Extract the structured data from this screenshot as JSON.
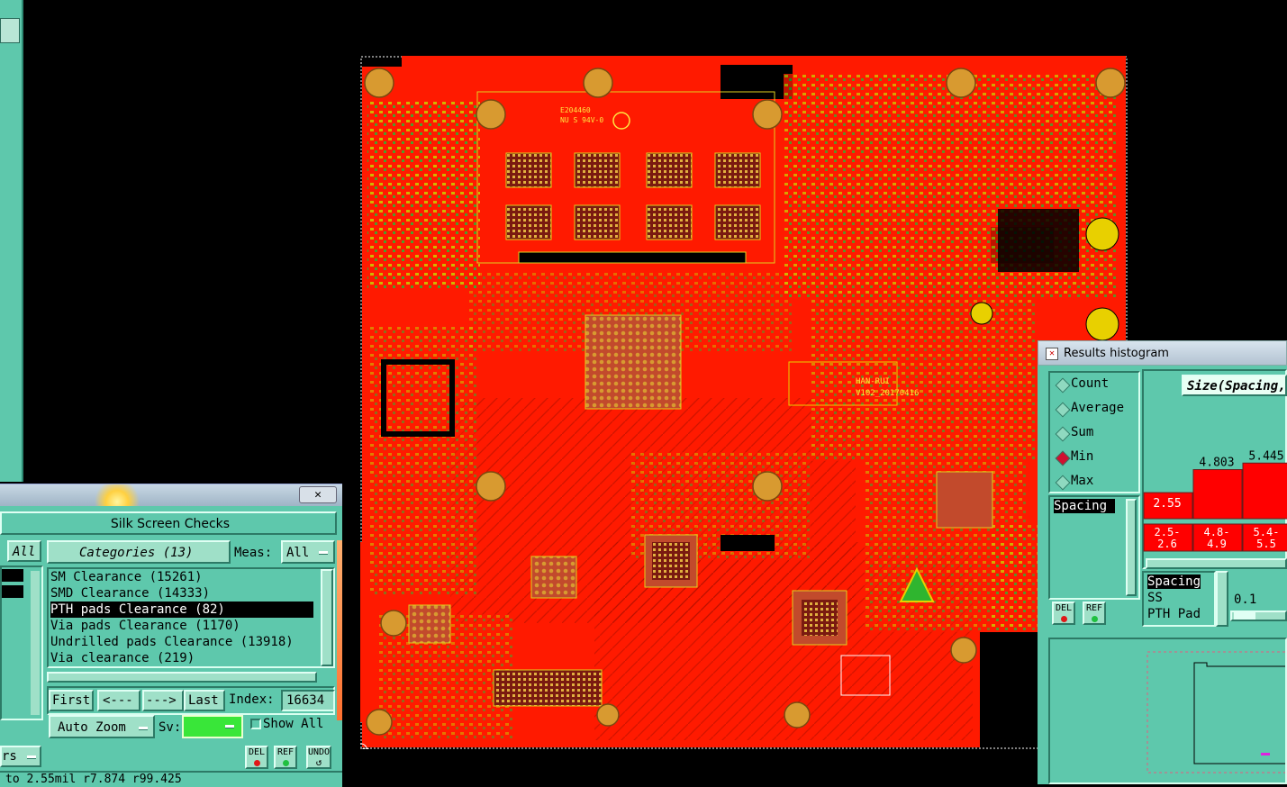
{
  "board": {
    "silk_texts": [
      "E204460",
      "NU S 94V-0",
      "HAN-RUI",
      "V102_20170416"
    ]
  },
  "silk_panel": {
    "title": "Silk Screen Checks",
    "close_symbol": "✕",
    "all_label": "All",
    "categories_label": "Categories (13)",
    "meas_label": "Meas:",
    "meas_value": "All",
    "categories": [
      "SM Clearance (15261)",
      "SMD Clearance (14333)",
      "PTH pads Clearance (82)",
      "Via pads Clearance (1170)",
      "Undrilled pads Clearance (13918)",
      "Via clearance (219)"
    ],
    "selected_index": 2,
    "nav": {
      "first": "First",
      "prev": "<---",
      "next": "--->",
      "last": "Last"
    },
    "index_label": "Index:",
    "index_value": "16634",
    "auto_zoom_label": "Auto Zoom",
    "sv_label": "Sv:",
    "show_all_label": "Show All",
    "left_dropdown_label": "rs",
    "del_label": "DEL",
    "ref_label": "REF",
    "undo_label": "UNDO",
    "status_text": "to 2.55mil  r7.874  r99.425"
  },
  "histogram": {
    "title": "Results histogram",
    "options": [
      "Count",
      "Average",
      "Sum",
      "Min",
      "Max"
    ],
    "selected_option": "Min",
    "chart_header": "Size(Spacing,",
    "list_items": [
      "Spacing"
    ],
    "del_label": "DEL",
    "ref_label": "REF",
    "bins": [
      {
        "value": "2.55",
        "range_top": "2.5-",
        "range_bottom": "2.6"
      },
      {
        "value": "4.803",
        "range_top": "4.8-",
        "range_bottom": "4.9"
      },
      {
        "value": "5.445",
        "range_top": "5.4-",
        "range_bottom": "5.5"
      }
    ],
    "legend_items": [
      "Spacing",
      "SS",
      "PTH Pad"
    ],
    "scale_value": "0.1"
  },
  "colors": {
    "panel": "#5ec8ac",
    "copper": "#ff1a00",
    "pad": "#d89a30",
    "bar": "#ff0000",
    "selected_radio": "#d01030"
  }
}
